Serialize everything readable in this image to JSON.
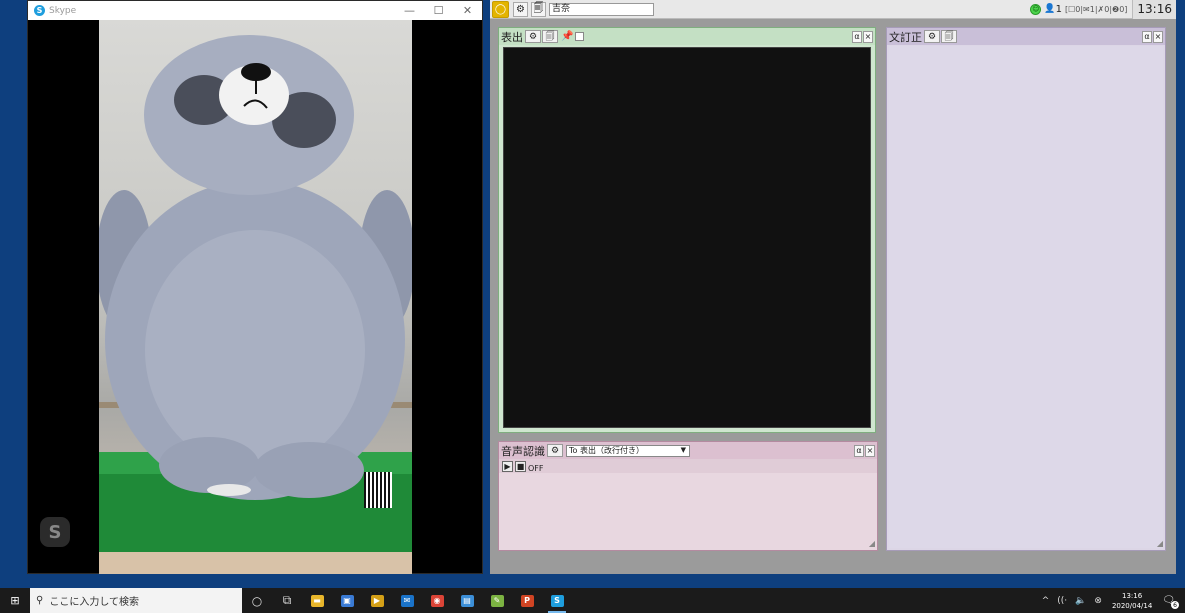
{
  "skype": {
    "title": "Skype",
    "logo_letter": "S",
    "controls": {
      "minimize": "—",
      "maximize": "☐",
      "close": "✕"
    },
    "watermark_letter": "S"
  },
  "app": {
    "logo_glyph": "◯",
    "toolbar": {
      "settings_glyph": "⚙",
      "memo_glyph": "🗐",
      "title_value": "吉奈"
    },
    "status": {
      "face_glyph": "☺",
      "user_glyph": "👤",
      "user_count": "1",
      "counters": "[☐0|✉1|✗0|❷0]"
    },
    "clock": "13:16",
    "panels": {
      "display": {
        "title": "表出",
        "settings_glyph": "⚙",
        "doc_glyph": "🗐",
        "pin_glyph": "📌",
        "alpha": "α",
        "close": "×"
      },
      "speech": {
        "title": "音声認識",
        "settings_glyph": "⚙",
        "target": "To 表出（改行付き）",
        "target_arrow": "▼",
        "play_glyph": "▶",
        "stop_glyph": "■",
        "status": "OFF",
        "alpha": "α",
        "close": "×"
      },
      "correct": {
        "title": "文訂正",
        "settings_glyph": "⚙",
        "doc_glyph": "🗐",
        "alpha": "α",
        "close": "×"
      }
    }
  },
  "taskbar": {
    "start_glyph": "⊞",
    "search_placeholder": "ここに入力して検索",
    "search_glyph": "⚲",
    "icons": [
      {
        "name": "cortana-icon",
        "glyph": "○"
      },
      {
        "name": "task-view-icon",
        "glyph": "⧉"
      },
      {
        "name": "file-explorer-icon",
        "glyph": "▬",
        "color": "#e8b62b"
      },
      {
        "name": "store-icon",
        "glyph": "▣",
        "color": "#3a7bd5"
      },
      {
        "name": "media-icon",
        "glyph": "▶",
        "color": "#d4a017"
      },
      {
        "name": "mail-icon",
        "glyph": "✉",
        "color": "#1a73c9"
      },
      {
        "name": "chrome-icon",
        "glyph": "◉",
        "color": "#db4437"
      },
      {
        "name": "app-icon",
        "glyph": "▤",
        "color": "#3c8fd8"
      },
      {
        "name": "paint-icon",
        "glyph": "✎",
        "color": "#7cb342"
      },
      {
        "name": "powerpoint-icon",
        "glyph": "P",
        "color": "#d04423"
      },
      {
        "name": "skype-icon",
        "glyph": "S",
        "color": "#1e9ede"
      }
    ],
    "tray": {
      "chevron": "^",
      "network": "((·",
      "volume": "🔈",
      "ime": "⊗",
      "time": "13:16",
      "date": "2020/04/14",
      "notifications_glyph": "🗨",
      "notifications_count": "6"
    }
  }
}
